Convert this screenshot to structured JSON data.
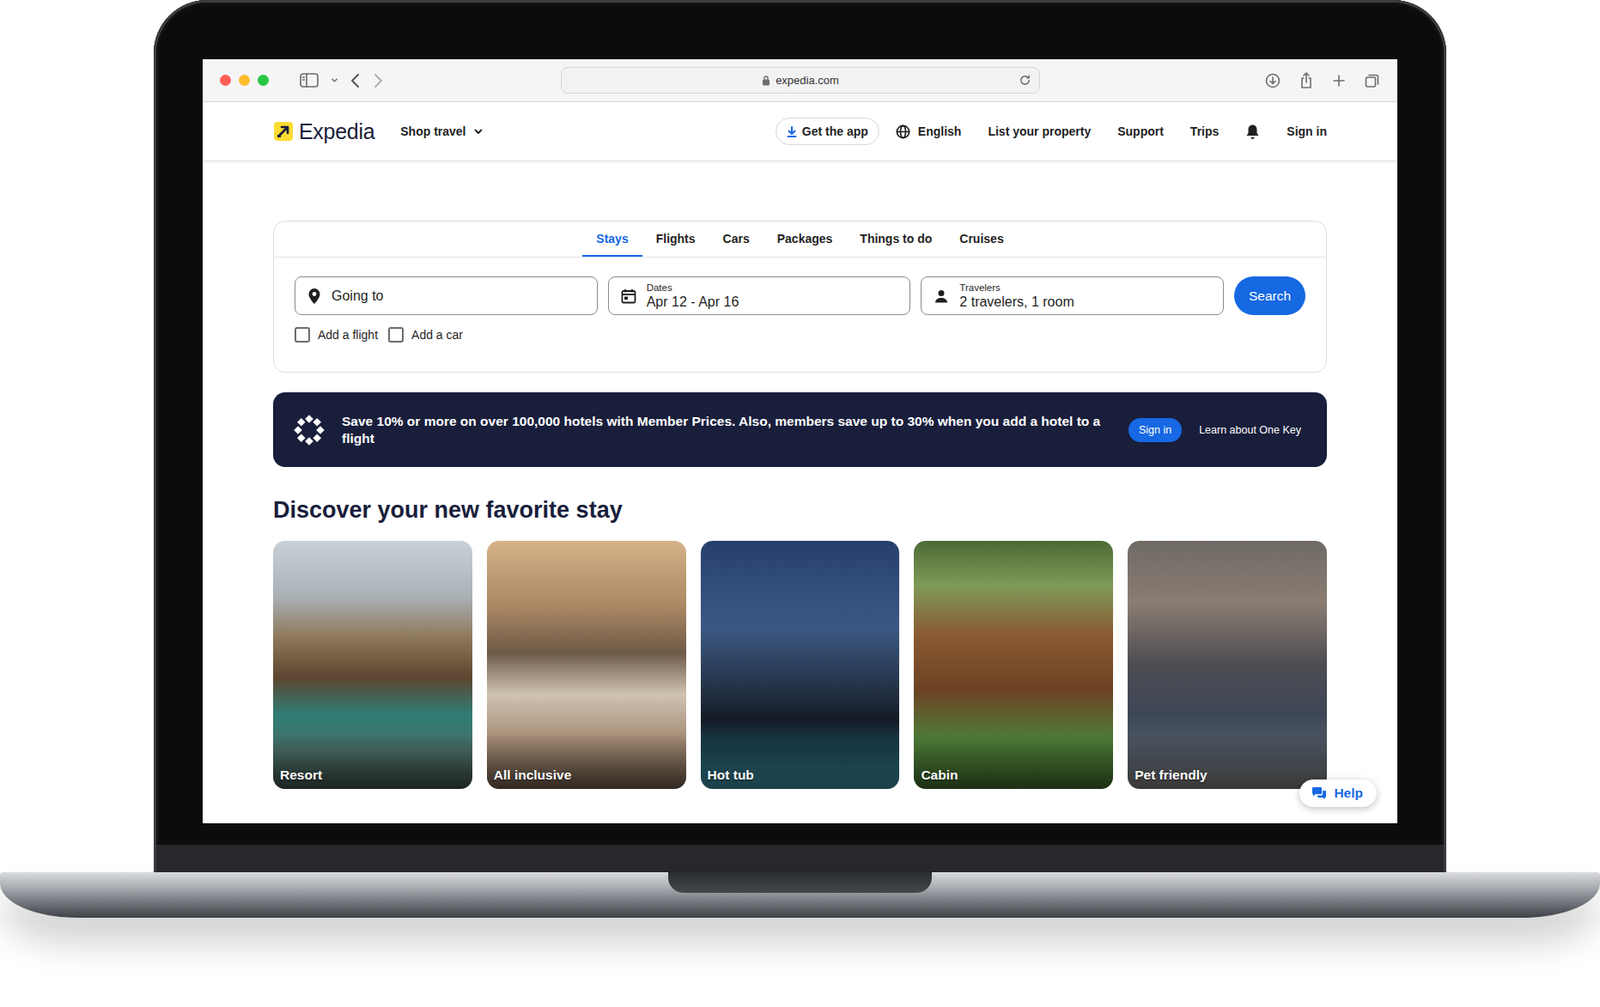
{
  "browser": {
    "url": "expedia.com"
  },
  "header": {
    "logo": "Expedia",
    "shop_travel": "Shop travel",
    "get_app": "Get the app",
    "language": "English",
    "nav": [
      "List your property",
      "Support",
      "Trips"
    ],
    "sign_in": "Sign in"
  },
  "search": {
    "tabs": [
      {
        "label": "Stays",
        "selected": true
      },
      {
        "label": "Flights",
        "selected": false
      },
      {
        "label": "Cars",
        "selected": false
      },
      {
        "label": "Packages",
        "selected": false
      },
      {
        "label": "Things to do",
        "selected": false
      },
      {
        "label": "Cruises",
        "selected": false
      }
    ],
    "destination": {
      "placeholder": "Going to"
    },
    "dates": {
      "label": "Dates",
      "value": "Apr 12 - Apr 16"
    },
    "travelers": {
      "label": "Travelers",
      "value": "2 travelers, 1 room"
    },
    "button": "Search",
    "options": [
      {
        "label": "Add a flight",
        "checked": false
      },
      {
        "label": "Add a car",
        "checked": false
      }
    ]
  },
  "banner": {
    "text": "Save 10% or more on over 100,000 hotels with Member Prices. Also, members save up to 30% when you add a hotel to a flight",
    "sign_in": "Sign in",
    "learn": "Learn about One Key"
  },
  "discover": {
    "title": "Discover your new favorite stay",
    "cards": [
      {
        "label": "Resort"
      },
      {
        "label": "All inclusive"
      },
      {
        "label": "Hot tub"
      },
      {
        "label": "Cabin"
      },
      {
        "label": "Pet friendly"
      }
    ]
  },
  "help": "Help"
}
